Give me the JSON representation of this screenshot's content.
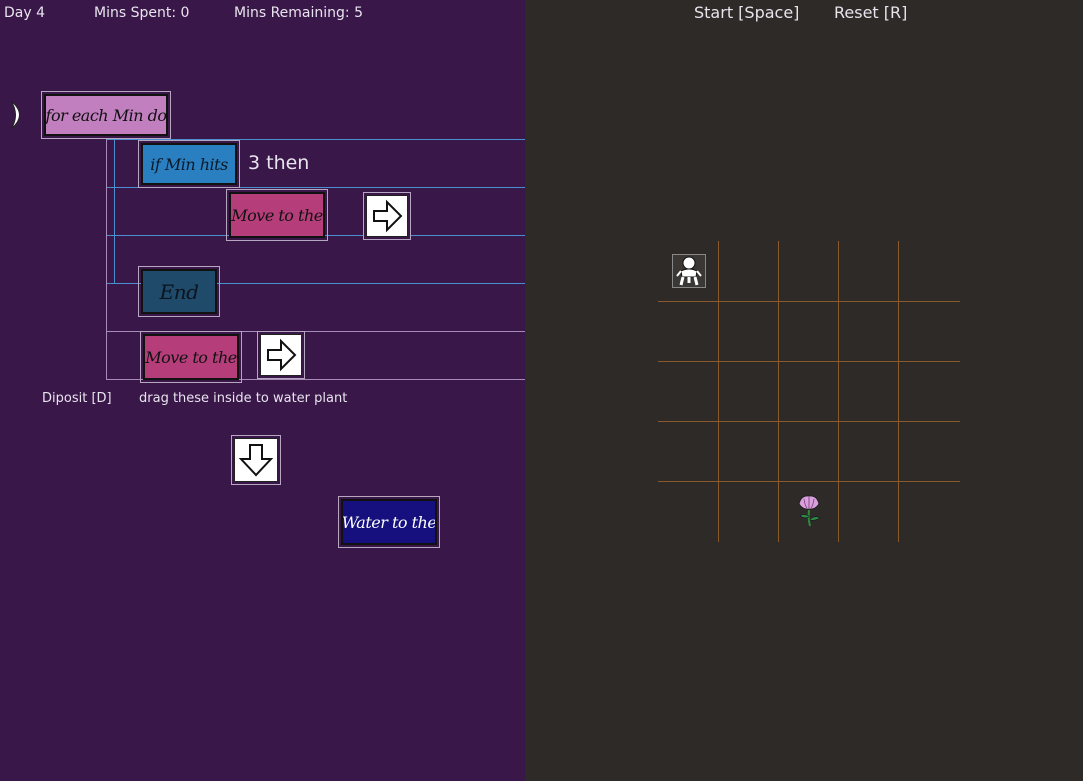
{
  "hud": {
    "day": "Day 4",
    "mins_spent": "Mins Spent: 0",
    "mins_remaining": "Mins Remaining: 5"
  },
  "controls": {
    "start": "Start [Space]",
    "reset": "Reset [R]"
  },
  "program": {
    "for_each_label": "for each Min do",
    "if_label": "if Min hits",
    "if_condition": "3 then",
    "move_label_1": "Move to the",
    "end_label": "End",
    "move_label_2": "Move to the"
  },
  "palette": {
    "deposit_hint": "Diposit  [D]",
    "drag_hint": "drag these inside to water plant",
    "water_label": "Water to the"
  },
  "colors": {
    "left_bg": "#3a1749",
    "right_bg": "#2d2a28",
    "for_each_block": "#c17fbf",
    "if_block": "#2a7fc0",
    "move_block": "#b53e7a",
    "end_block": "#1f4a6a",
    "water_block": "#16107e",
    "grid_line": "#8a5a2a"
  },
  "icons": {
    "run_pointer": "pointer-arrow-icon",
    "arrow_right_1": "arrow-right-icon",
    "arrow_right_2": "arrow-right-icon",
    "arrow_down": "arrow-down-icon",
    "player": "robot-person-icon",
    "plant": "flower-plant-icon"
  }
}
